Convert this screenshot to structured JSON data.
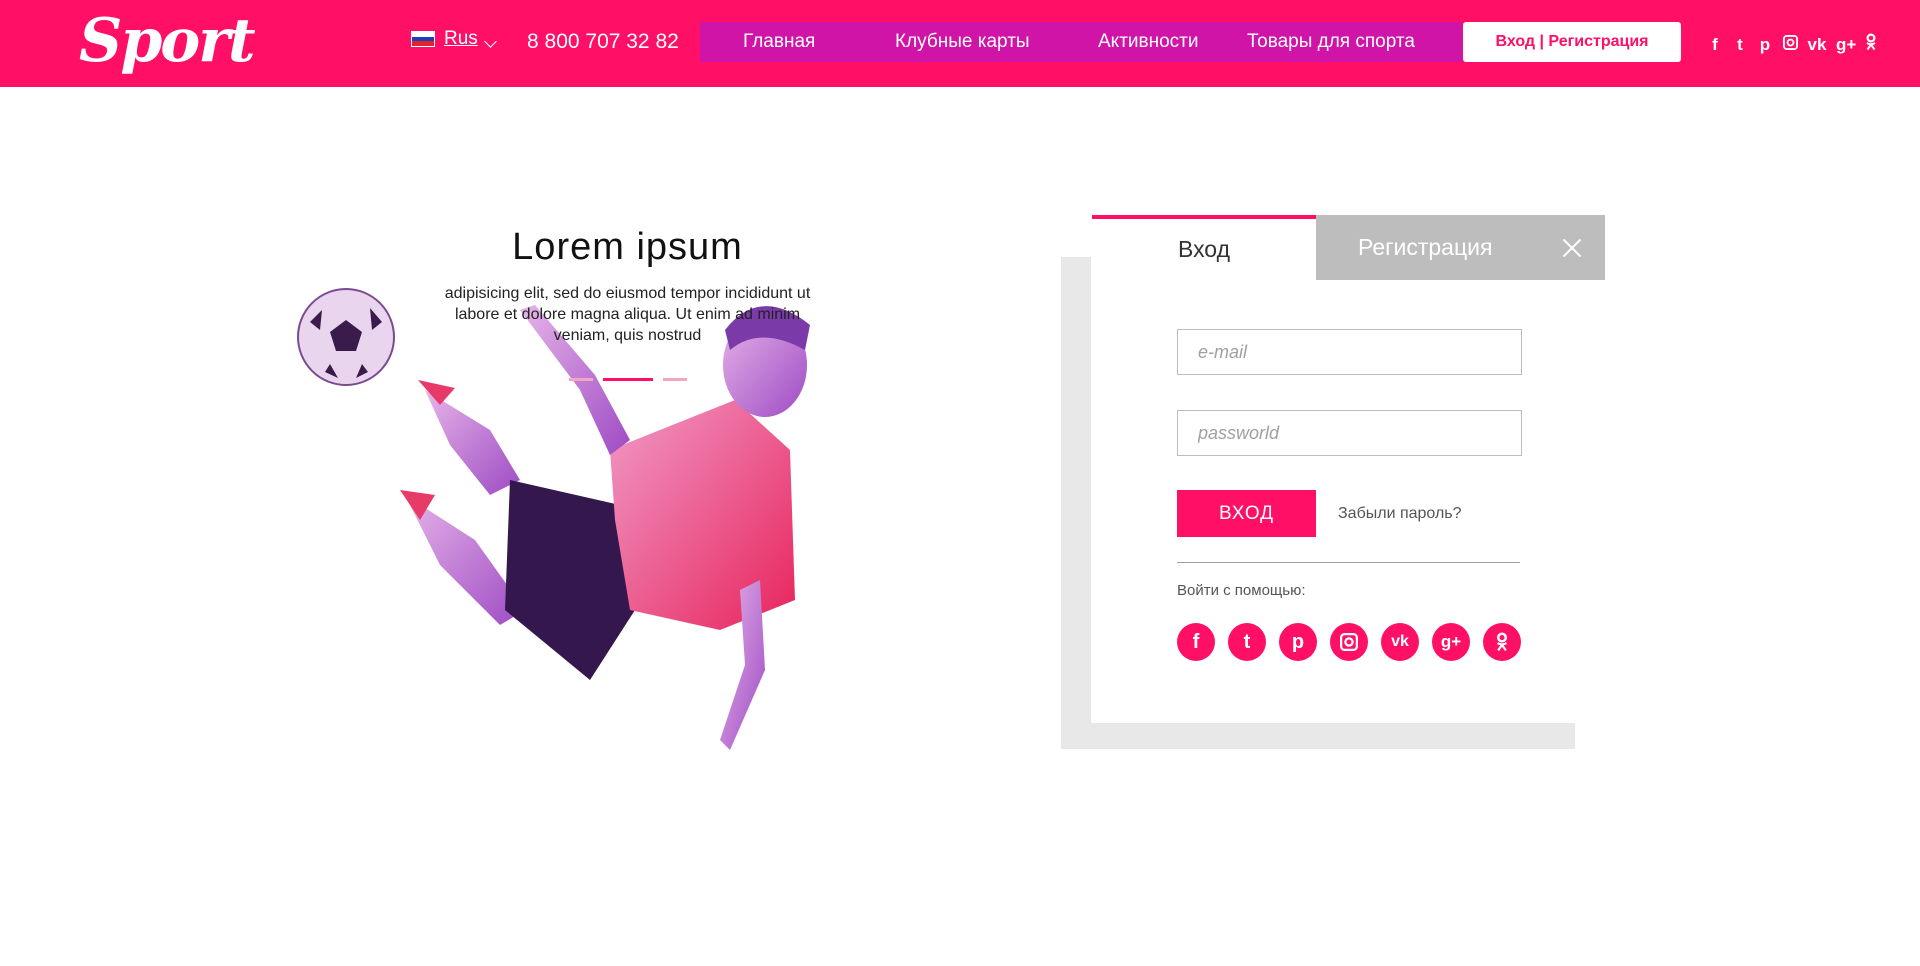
{
  "brand": {
    "logo_text": "Sport",
    "accent": "#ff0f66",
    "nav_bg": "#d114a8"
  },
  "header": {
    "language": {
      "label": "Rus",
      "flag": "russia-flag-icon"
    },
    "phone": "8 800 707 32 82",
    "nav": [
      {
        "label": "Главная"
      },
      {
        "label": "Клубные карты"
      },
      {
        "label": "Активности"
      },
      {
        "label": "Товары для спорта"
      }
    ],
    "auth_button": "Вход | Регистрация",
    "social_icons": [
      "facebook-icon",
      "twitter-icon",
      "pinterest-icon",
      "instagram-icon",
      "vk-icon",
      "google-plus-icon",
      "odnoklassniki-icon"
    ]
  },
  "hero": {
    "title": "Lorem ipsum",
    "text": "adipisicing elit, sed do eiusmod tempor incididunt ut labore et dolore magna aliqua. Ut enim ad minim veniam, quis nostrud",
    "slides_count": 3,
    "active_slide": 2
  },
  "auth": {
    "tabs": [
      {
        "label": "Вход",
        "active": true
      },
      {
        "label": "Регистрация",
        "active": false
      }
    ],
    "email_placeholder": "e-mail",
    "password_placeholder": "passworld",
    "submit_label": "ВХОД",
    "forgot_label": "Забыли пароль?",
    "social_label": "Войти с помощью:",
    "social_icons": [
      "facebook-icon",
      "twitter-icon",
      "pinterest-icon",
      "instagram-icon",
      "vk-icon",
      "google-plus-icon",
      "odnoklassniki-icon"
    ]
  }
}
